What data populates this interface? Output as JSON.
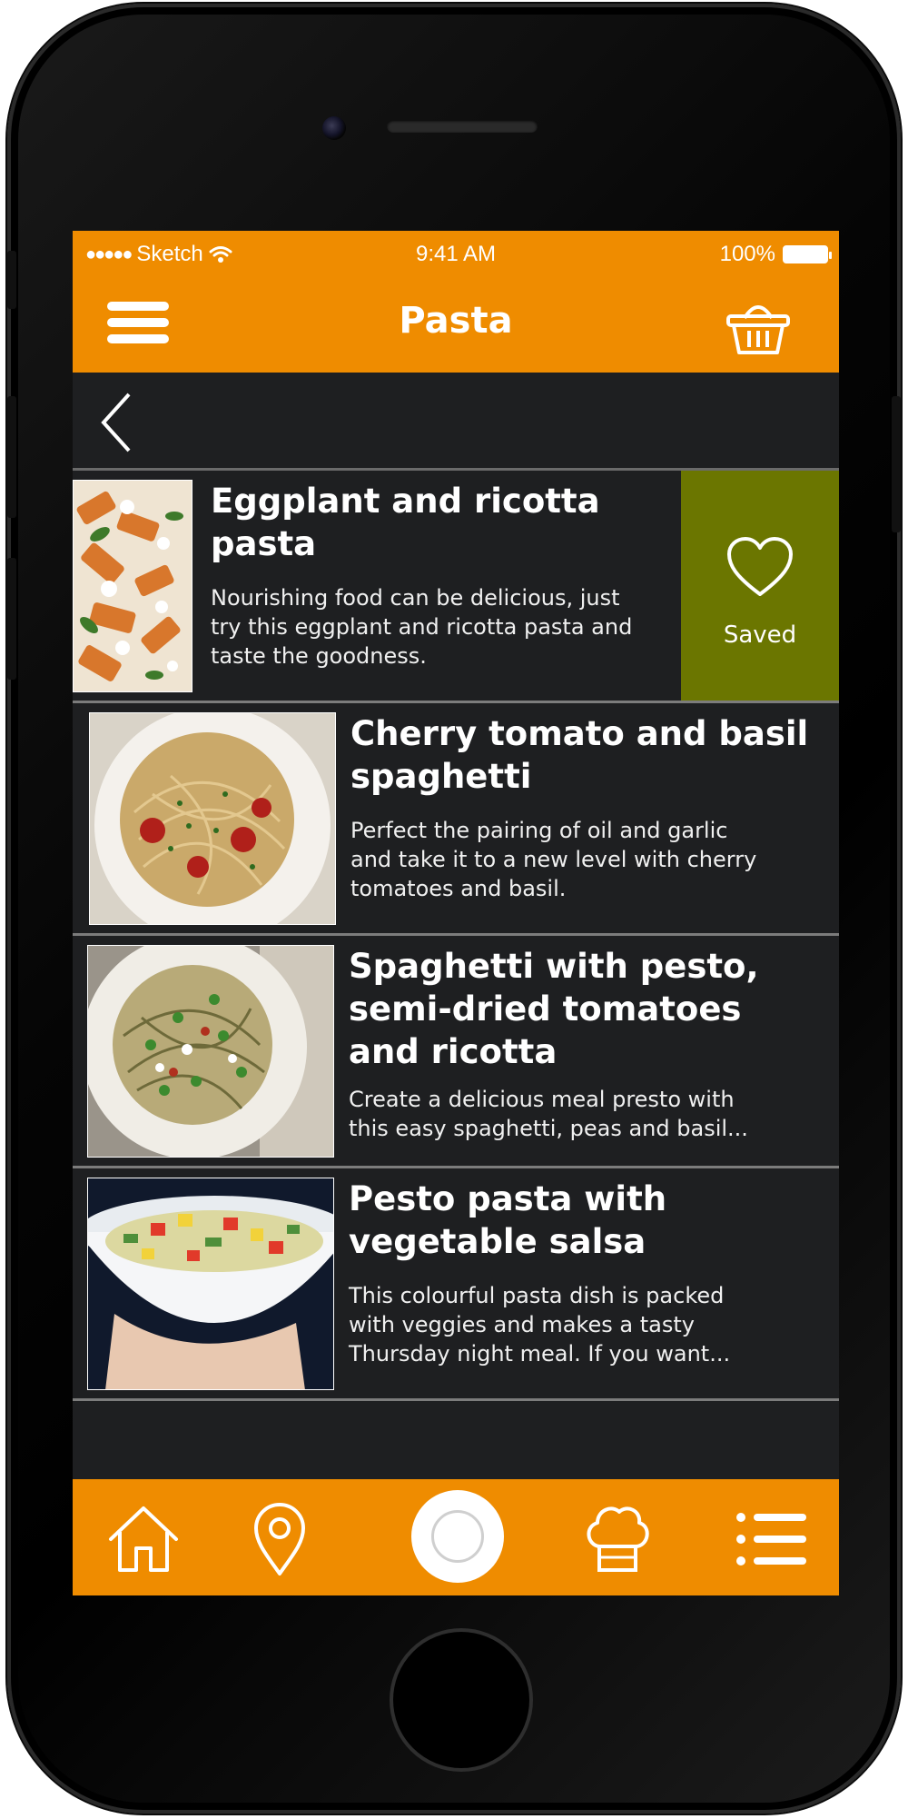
{
  "status_bar": {
    "signal_dots": "●●●●●",
    "carrier": "Sketch",
    "time": "9:41 AM",
    "battery": "100%"
  },
  "nav": {
    "title": "Pasta"
  },
  "recipes": [
    {
      "title_line1": "Eggplant and ricotta",
      "title_line2": "pasta",
      "title_line3": "",
      "desc_line1": "Nourishing food can be delicious, just",
      "desc_line2": "try this eggplant and ricotta pasta and",
      "desc_line3": "taste the goodness.",
      "saved_label": "Saved"
    },
    {
      "title_line1": "Cherry tomato and basil",
      "title_line2": "spaghetti",
      "title_line3": "",
      "desc_line1": "Perfect the pairing of oil and garlic",
      "desc_line2": "and take it to a new level with cherry",
      "desc_line3": "tomatoes and basil."
    },
    {
      "title_line1": "Spaghetti with pesto,",
      "title_line2": "semi-dried tomatoes",
      "title_line3": "and ricotta",
      "desc_line1": "Create a delicious meal presto with",
      "desc_line2": "this easy spaghetti, peas and basil...",
      "desc_line3": ""
    },
    {
      "title_line1": "Pesto pasta with",
      "title_line2": "vegetable salsa",
      "title_line3": "",
      "desc_line1": "This colourful pasta dish is packed",
      "desc_line2": "with veggies and makes a tasty",
      "desc_line3": "Thursday night meal. If you want..."
    }
  ],
  "icons": {
    "menu": "hamburger-icon",
    "cart": "basket-icon",
    "back": "chevron-left-icon",
    "saved": "heart-icon",
    "tabs": [
      "home-icon",
      "location-pin-icon",
      "record-icon",
      "chef-hat-icon",
      "list-icon"
    ]
  },
  "colors": {
    "accent": "#ef8c00",
    "saved_bg": "#6b7600",
    "background": "#1e1f21"
  }
}
